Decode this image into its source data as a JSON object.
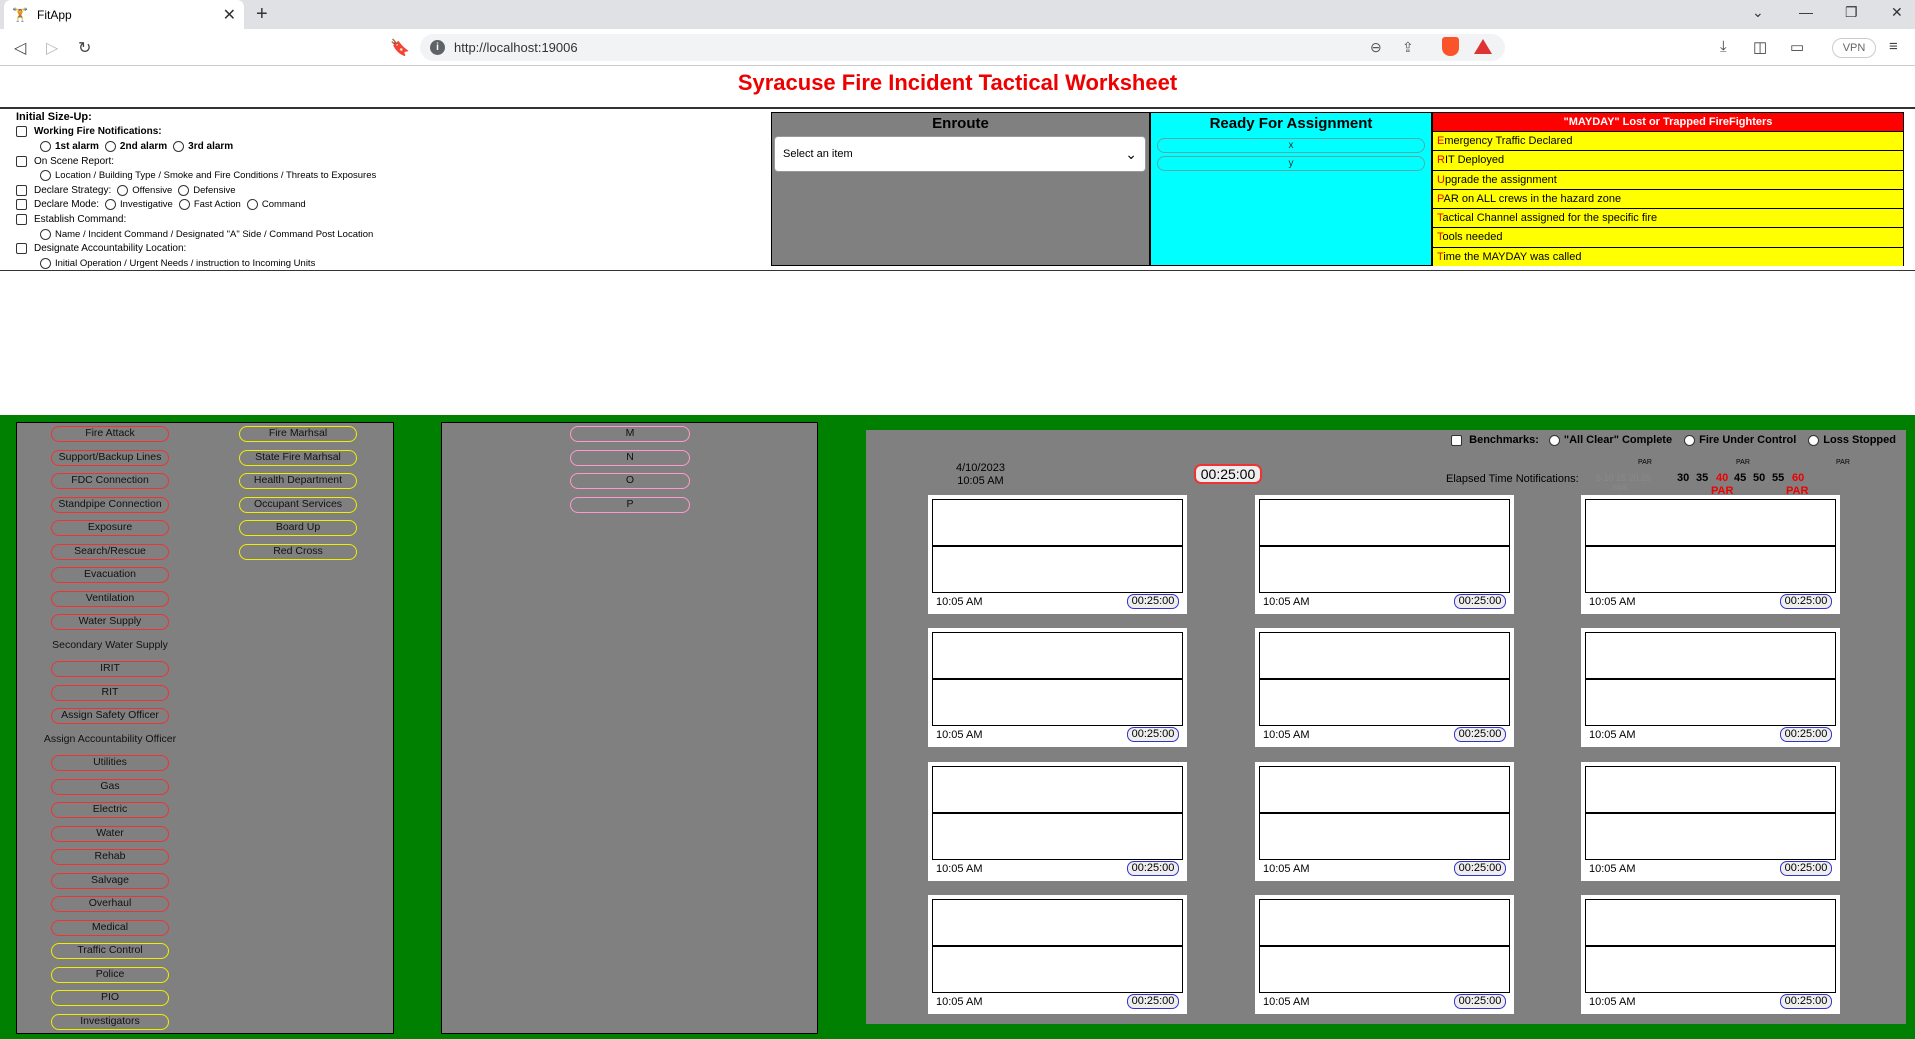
{
  "browser": {
    "tab_title": "FitApp",
    "url": "http://localhost:19006",
    "vpn_label": "VPN"
  },
  "page": {
    "title": "Syracuse Fire Incident Tactical Worksheet"
  },
  "sizeup": {
    "heading": "Initial Size-Up:",
    "working_fire": "Working Fire Notifications:",
    "alarm1": "1st alarm",
    "alarm2": "2nd alarm",
    "alarm3": "3rd alarm",
    "on_scene": "On Scene Report:",
    "on_scene_detail": "Location / Building Type / Smoke and Fire Conditions / Threats to Exposures",
    "strategy": "Declare Strategy:",
    "offensive": "Offensive",
    "defensive": "Defensive",
    "mode": "Declare Mode:",
    "investigative": "Investigative",
    "fast_action": "Fast Action",
    "command": "Command",
    "establish": "Establish Command:",
    "establish_detail": "Name / Incident Command / Designated \"A\" Side / Command Post Location",
    "accountability": "Designate Accountability Location:",
    "accountability_detail": "Initial Operation / Urgent Needs / instruction to Incoming Units"
  },
  "enroute": {
    "heading": "Enroute",
    "select_value": "Select an item"
  },
  "ready": {
    "heading": "Ready For Assignment",
    "items": [
      "x",
      "y"
    ]
  },
  "mayday": {
    "heading": "\"MAYDAY\" Lost or Trapped FireFighters",
    "items": [
      {
        "first": "E",
        "rest": "mergency Traffic Declared"
      },
      {
        "first": "R",
        "rest": "IT Deployed"
      },
      {
        "first": "U",
        "rest": "pgrade the assignment"
      },
      {
        "first": "P",
        "rest": "AR on ALL crews in the hazard zone"
      },
      {
        "first": "T",
        "rest": "actical Channel assigned for the specific fire"
      },
      {
        "first": "T",
        "rest": "ools needed"
      },
      {
        "first": "T",
        "rest": "ime the MAYDAY was called"
      }
    ]
  },
  "assignments_col1": [
    "Fire Attack",
    "Support/Backup Lines",
    "FDC Connection",
    "Standpipe Connection",
    "Exposure",
    "Search/Rescue",
    "Evacuation",
    "Ventilation",
    "Water Supply",
    "Secondary Water Supply",
    "IRIT",
    "RIT",
    "Assign Safety Officer",
    "Assign Accountability Officer",
    "Utilities",
    "Gas",
    "Electric",
    "Water",
    "Rehab",
    "Salvage",
    "Overhaul",
    "Medical",
    "Traffic Control",
    "Police",
    "PIO",
    "Investigators"
  ],
  "assignments_col2": [
    "Fire Marhsal",
    "State Fire Marhsal",
    "Health Department",
    "Occupant Services",
    "Board Up",
    "Red Cross"
  ],
  "units": [
    "M",
    "N",
    "O",
    "P"
  ],
  "benchmarks": {
    "label": "Benchmarks:",
    "all_clear": "\"All Clear\" Complete",
    "under_control": "Fire Under Control",
    "loss_stopped": "Loss Stopped"
  },
  "timer": {
    "date": "4/10/2023",
    "time": "10:05 AM",
    "clock": "00:25:00",
    "elapsed_label": "Elapsed Time Notifications:",
    "faded_numbers": "5 10 15 20 25",
    "n30": "30",
    "n35": "35",
    "n40": "40",
    "n45": "45",
    "n50": "50",
    "n55": "55",
    "n60": "60",
    "par": "PAR",
    "par_faded": "PAR"
  },
  "grid_cells": [
    {
      "time": "10:05 AM",
      "clock": "00:25:00"
    },
    {
      "time": "10:05 AM",
      "clock": "00:25:00"
    },
    {
      "time": "10:05 AM",
      "clock": "00:25:00"
    },
    {
      "time": "10:05 AM",
      "clock": "00:25:00"
    },
    {
      "time": "10:05 AM",
      "clock": "00:25:00"
    },
    {
      "time": "10:05 AM",
      "clock": "00:25:00"
    },
    {
      "time": "10:05 AM",
      "clock": "00:25:00"
    },
    {
      "time": "10:05 AM",
      "clock": "00:25:00"
    },
    {
      "time": "10:05 AM",
      "clock": "00:25:00"
    },
    {
      "time": "10:05 AM",
      "clock": "00:25:00"
    },
    {
      "time": "10:05 AM",
      "clock": "00:25:00"
    },
    {
      "time": "10:05 AM",
      "clock": "00:25:00"
    }
  ],
  "colors": {
    "title_red": "#ee0000",
    "enroute_gray": "#808080",
    "ready_cyan": "#00ffff",
    "mayday_red": "#ff0000",
    "mayday_yellow": "#ffff00",
    "panel_green": "#008000"
  }
}
